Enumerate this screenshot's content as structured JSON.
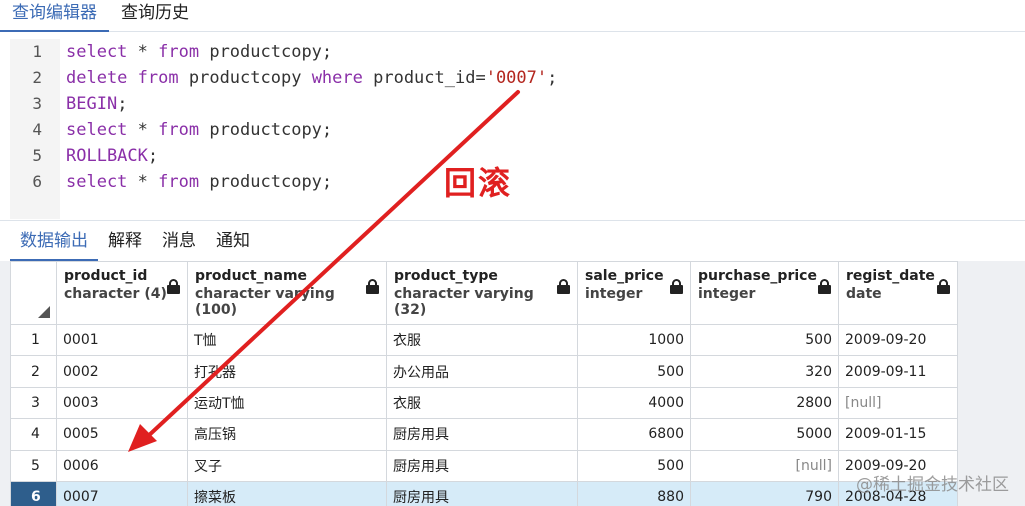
{
  "top_tabs": [
    {
      "label": "查询编辑器",
      "active": true
    },
    {
      "label": "查询历史",
      "active": false
    }
  ],
  "editor": {
    "line_numbers": [
      "1",
      "2",
      "3",
      "4",
      "5",
      "6"
    ],
    "lines": [
      [
        {
          "t": "select",
          "c": "kw"
        },
        {
          "t": " * "
        },
        {
          "t": "from",
          "c": "kw"
        },
        {
          "t": " productcopy;"
        }
      ],
      [
        {
          "t": "delete",
          "c": "kw"
        },
        {
          "t": " "
        },
        {
          "t": "from",
          "c": "kw"
        },
        {
          "t": " productcopy "
        },
        {
          "t": "where",
          "c": "kw"
        },
        {
          "t": " product_id="
        },
        {
          "t": "'0007'",
          "c": "str"
        },
        {
          "t": ";"
        }
      ],
      [
        {
          "t": "BEGIN",
          "c": "kw"
        },
        {
          "t": ";"
        }
      ],
      [
        {
          "t": "select",
          "c": "kw"
        },
        {
          "t": " * "
        },
        {
          "t": "from",
          "c": "kw"
        },
        {
          "t": " productcopy;"
        }
      ],
      [
        {
          "t": "ROLLBACK",
          "c": "kw"
        },
        {
          "t": ";"
        }
      ],
      [
        {
          "t": "select",
          "c": "kw"
        },
        {
          "t": " * "
        },
        {
          "t": "from",
          "c": "kw"
        },
        {
          "t": " productcopy;"
        }
      ]
    ]
  },
  "annotation": {
    "text": "回滚",
    "color": "#e02020"
  },
  "output_tabs": [
    {
      "label": "数据输出",
      "active": true
    },
    {
      "label": "解释",
      "active": false
    },
    {
      "label": "消息",
      "active": false
    },
    {
      "label": "通知",
      "active": false
    }
  ],
  "table": {
    "columns": [
      {
        "name": "product_id",
        "type": "character (4)",
        "width": 131
      },
      {
        "name": "product_name",
        "type": "character varying (100)",
        "width": 199
      },
      {
        "name": "product_type",
        "type": "character varying (32)",
        "width": 191
      },
      {
        "name": "sale_price",
        "type": "integer",
        "width": 113
      },
      {
        "name": "purchase_price",
        "type": "integer",
        "width": 148
      },
      {
        "name": "regist_date",
        "type": "date",
        "width": 119
      }
    ],
    "numeric_columns": [
      3,
      4
    ],
    "rows": [
      {
        "num": "1",
        "cells": [
          "0001",
          "T恤",
          "衣服",
          "1000",
          "500",
          "2009-09-20"
        ]
      },
      {
        "num": "2",
        "cells": [
          "0002",
          "打孔器",
          "办公用品",
          "500",
          "320",
          "2009-09-11"
        ]
      },
      {
        "num": "3",
        "cells": [
          "0003",
          "运动T恤",
          "衣服",
          "4000",
          "2800",
          "[null]"
        ]
      },
      {
        "num": "4",
        "cells": [
          "0005",
          "高压锅",
          "厨房用具",
          "6800",
          "5000",
          "2009-01-15"
        ]
      },
      {
        "num": "5",
        "cells": [
          "0006",
          "叉子",
          "厨房用具",
          "500",
          "[null]",
          "2009-09-20"
        ]
      },
      {
        "num": "6",
        "cells": [
          "0007",
          "擦菜板",
          "厨房用具",
          "880",
          "790",
          "2008-04-28"
        ],
        "selected": true
      }
    ]
  },
  "watermark": "@稀土掘金技术社区"
}
